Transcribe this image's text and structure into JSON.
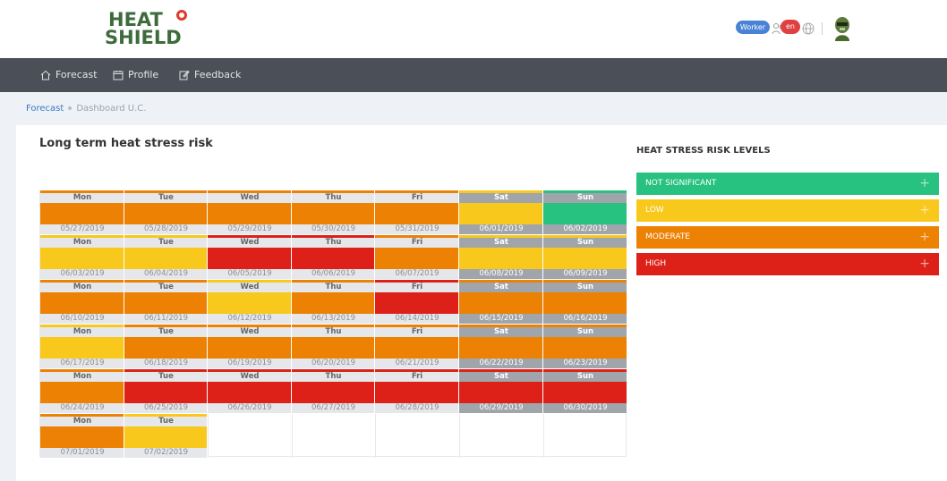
{
  "header": {
    "logo": {
      "line1": "HEAT",
      "line2": "SHIELD"
    },
    "role_badge": "Worker",
    "lang_badge": "en"
  },
  "nav": {
    "items": [
      {
        "label": "Forecast",
        "icon": "home-icon"
      },
      {
        "label": "Profile",
        "icon": "calendar-icon"
      },
      {
        "label": "Feedback",
        "icon": "edit-icon"
      }
    ]
  },
  "breadcrumb": {
    "items": [
      "Forecast",
      "Dashboard U.C."
    ]
  },
  "page": {
    "title": "Long term heat stress risk"
  },
  "colors": {
    "not_significant": "#27c180",
    "low": "#f8c81c",
    "moderate": "#ec8104",
    "high": "#dd2119"
  },
  "legend": {
    "title": "HEAT STRESS RISK LEVELS",
    "items": [
      {
        "label": "NOT SIGNIFICANT",
        "level": "not_significant"
      },
      {
        "label": "LOW",
        "level": "low"
      },
      {
        "label": "MODERATE",
        "level": "moderate"
      },
      {
        "label": "HIGH",
        "level": "high"
      }
    ]
  },
  "calendar": {
    "weekdays": [
      "Mon",
      "Tue",
      "Wed",
      "Thu",
      "Fri",
      "Sat",
      "Sun"
    ],
    "weeks": [
      [
        {
          "date": "05/27/2019",
          "level": "moderate"
        },
        {
          "date": "05/28/2019",
          "level": "moderate"
        },
        {
          "date": "05/29/2019",
          "level": "moderate"
        },
        {
          "date": "05/30/2019",
          "level": "moderate"
        },
        {
          "date": "05/31/2019",
          "level": "moderate"
        },
        {
          "date": "06/01/2019",
          "level": "low"
        },
        {
          "date": "06/02/2019",
          "level": "not_significant"
        }
      ],
      [
        {
          "date": "06/03/2019",
          "level": "low"
        },
        {
          "date": "06/04/2019",
          "level": "low"
        },
        {
          "date": "06/05/2019",
          "level": "high"
        },
        {
          "date": "06/06/2019",
          "level": "high"
        },
        {
          "date": "06/07/2019",
          "level": "moderate"
        },
        {
          "date": "06/08/2019",
          "level": "low"
        },
        {
          "date": "06/09/2019",
          "level": "low"
        }
      ],
      [
        {
          "date": "06/10/2019",
          "level": "moderate"
        },
        {
          "date": "06/11/2019",
          "level": "moderate"
        },
        {
          "date": "06/12/2019",
          "level": "low"
        },
        {
          "date": "06/13/2019",
          "level": "moderate"
        },
        {
          "date": "06/14/2019",
          "level": "high"
        },
        {
          "date": "06/15/2019",
          "level": "moderate"
        },
        {
          "date": "06/16/2019",
          "level": "moderate"
        }
      ],
      [
        {
          "date": "06/17/2019",
          "level": "low"
        },
        {
          "date": "06/18/2019",
          "level": "moderate"
        },
        {
          "date": "06/19/2019",
          "level": "moderate"
        },
        {
          "date": "06/20/2019",
          "level": "moderate"
        },
        {
          "date": "06/21/2019",
          "level": "moderate"
        },
        {
          "date": "06/22/2019",
          "level": "moderate"
        },
        {
          "date": "06/23/2019",
          "level": "moderate"
        }
      ],
      [
        {
          "date": "06/24/2019",
          "level": "moderate"
        },
        {
          "date": "06/25/2019",
          "level": "high"
        },
        {
          "date": "06/26/2019",
          "level": "high"
        },
        {
          "date": "06/27/2019",
          "level": "high"
        },
        {
          "date": "06/28/2019",
          "level": "high"
        },
        {
          "date": "06/29/2019",
          "level": "high"
        },
        {
          "date": "06/30/2019",
          "level": "high"
        }
      ],
      [
        {
          "date": "07/01/2019",
          "level": "moderate"
        },
        {
          "date": "07/02/2019",
          "level": "low"
        }
      ]
    ]
  }
}
